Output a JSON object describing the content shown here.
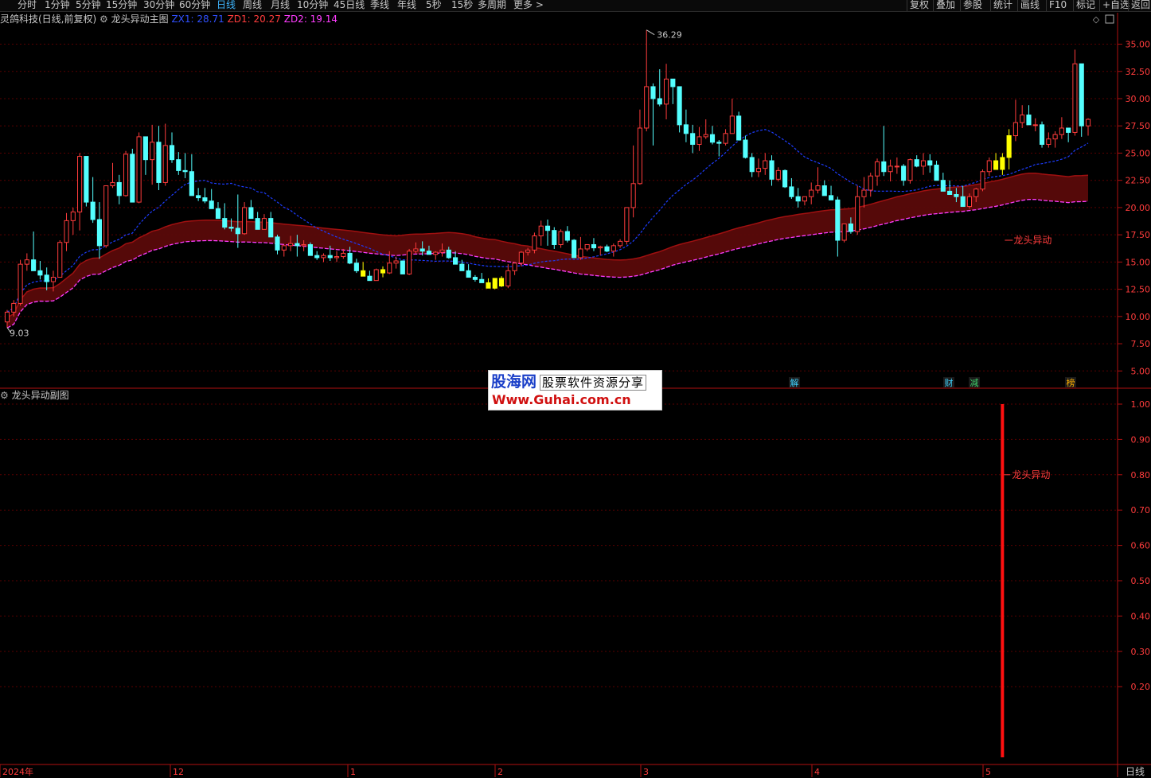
{
  "toolbar": {
    "periods": [
      "分时",
      "1分钟",
      "5分钟",
      "15分钟",
      "30分钟",
      "60分钟",
      "日线",
      "周线",
      "月线",
      "10分钟",
      "45日线",
      "季线",
      "年线",
      "5秒",
      "15秒",
      "多周期",
      "更多 >"
    ],
    "active_period": "日线",
    "right_buttons": [
      "复权",
      "叠加",
      "参股",
      "统计",
      "画线",
      "F10",
      "标记",
      "+自选",
      "返回"
    ]
  },
  "main_panel": {
    "stock": "灵鸽科技(日线,前复权)",
    "indicator_name": "龙头异动主图",
    "zx1_label": "ZX1: 28.71",
    "zd1_label": "ZD1: 20.27",
    "zd2_label": "ZD2: 19.14",
    "high_marker": "36.29",
    "low_marker": "9.03",
    "signal_label": "龙头异动",
    "event_badges": [
      "解",
      "财",
      "减",
      "榜"
    ]
  },
  "sub_panel": {
    "indicator_name": "龙头异动副图",
    "signal_label": "龙头异动"
  },
  "watermark": {
    "brand": "股海网",
    "tagline": "股票软件资源分享",
    "url": "Www.Guhai.com.cn"
  },
  "date_axis": [
    "2024年",
    "12",
    "1",
    "2",
    "3",
    "4",
    "5"
  ],
  "period_label": "日线",
  "colors": {
    "up": "#ff3c3c",
    "down": "#54ffff",
    "signal": "#ffff00",
    "ma_blue": "#1d3cff",
    "ma_magenta": "#ff3cff",
    "band_fill": "#5a0a0a",
    "grid": "#5a0000"
  },
  "chart_data": [
    {
      "type": "candlestick",
      "title": "龙头异动主图",
      "y_ticks": [
        35.0,
        32.5,
        30.0,
        27.5,
        25.0,
        22.5,
        20.0,
        17.5,
        15.0,
        12.5,
        10.0,
        7.5,
        5.0
      ],
      "ylim": [
        4.0,
        36.5
      ],
      "x_ticks": [
        "2024年",
        "12",
        "1",
        "2",
        "3",
        "4",
        "5"
      ],
      "ohlc": [
        [
          9.5,
          10.6,
          9.0,
          10.4
        ],
        [
          10.4,
          11.5,
          10.0,
          11.2
        ],
        [
          11.2,
          15.2,
          11.0,
          14.8
        ],
        [
          14.8,
          15.8,
          14.2,
          15.2
        ],
        [
          15.2,
          17.8,
          14.6,
          14.2
        ],
        [
          14.2,
          15.1,
          13.4,
          13.8
        ],
        [
          13.8,
          14.5,
          12.4,
          13.2
        ],
        [
          13.2,
          14.2,
          12.3,
          13.6
        ],
        [
          13.6,
          17.0,
          13.6,
          16.8
        ],
        [
          16.8,
          19.5,
          16.0,
          18.8
        ],
        [
          18.8,
          20.0,
          17.5,
          19.6
        ],
        [
          19.6,
          25.0,
          17.9,
          24.7
        ],
        [
          24.7,
          23.5,
          20.1,
          20.5
        ],
        [
          20.5,
          22.8,
          18.6,
          18.9
        ],
        [
          18.9,
          20.5,
          15.3,
          16.5
        ],
        [
          16.5,
          22.0,
          16.3,
          22.0
        ],
        [
          22.0,
          24.1,
          21.8,
          22.3
        ],
        [
          22.3,
          23.0,
          20.3,
          21.1
        ],
        [
          21.1,
          25.2,
          21.0,
          24.9
        ],
        [
          24.9,
          25.4,
          21.3,
          20.5
        ],
        [
          20.5,
          26.9,
          20.4,
          26.5
        ],
        [
          26.5,
          25.5,
          23.0,
          24.4
        ],
        [
          24.4,
          27.6,
          22.1,
          26.0
        ],
        [
          26.0,
          27.5,
          21.6,
          22.3
        ],
        [
          22.3,
          27.7,
          22.0,
          25.7
        ],
        [
          25.7,
          26.9,
          24.1,
          24.4
        ],
        [
          24.4,
          25.1,
          23.0,
          23.4
        ],
        [
          23.4,
          25.0,
          22.7,
          23.3
        ],
        [
          23.3,
          24.9,
          21.3,
          21.1
        ],
        [
          21.1,
          21.8,
          20.6,
          20.9
        ],
        [
          20.9,
          21.8,
          20.4,
          20.6
        ],
        [
          20.6,
          21.7,
          20.1,
          19.9
        ],
        [
          19.9,
          20.5,
          19.0,
          19.0
        ],
        [
          19.0,
          20.4,
          18.0,
          18.2
        ],
        [
          18.2,
          19.0,
          17.8,
          18.1
        ],
        [
          18.1,
          21.2,
          16.3,
          17.6
        ],
        [
          17.6,
          20.5,
          17.5,
          20.0
        ],
        [
          20.0,
          20.7,
          19.1,
          19.0
        ],
        [
          19.0,
          19.6,
          18.5,
          18.0
        ],
        [
          18.0,
          19.4,
          18.1,
          19.0
        ],
        [
          19.0,
          19.6,
          17.4,
          17.3
        ],
        [
          17.3,
          17.5,
          15.7,
          16.1
        ],
        [
          16.1,
          16.6,
          15.5,
          16.5
        ],
        [
          16.5,
          17.4,
          16.0,
          16.7
        ],
        [
          16.7,
          17.5,
          15.5,
          16.5
        ],
        [
          16.5,
          17.0,
          16.0,
          16.6
        ],
        [
          16.6,
          16.8,
          15.7,
          15.6
        ],
        [
          15.6,
          16.0,
          15.2,
          15.4
        ],
        [
          15.4,
          15.8,
          15.0,
          15.6
        ],
        [
          15.6,
          16.5,
          15.1,
          15.4
        ],
        [
          15.4,
          16.0,
          15.0,
          15.5
        ],
        [
          15.5,
          16.2,
          15.3,
          15.8
        ],
        [
          15.8,
          16.4,
          14.8,
          14.9
        ],
        [
          14.9,
          15.3,
          14.0,
          14.2
        ],
        [
          14.2,
          15.0,
          13.7,
          13.7
        ],
        [
          13.7,
          14.2,
          13.4,
          13.3
        ],
        [
          13.3,
          14.4,
          13.5,
          14.3
        ],
        [
          14.3,
          14.6,
          13.6,
          14.0
        ],
        [
          14.0,
          16.0,
          13.9,
          14.9
        ],
        [
          14.9,
          15.5,
          14.4,
          15.1
        ],
        [
          15.1,
          15.0,
          14.2,
          13.9
        ],
        [
          13.9,
          16.2,
          13.8,
          16.0
        ],
        [
          16.0,
          16.8,
          15.8,
          16.2
        ],
        [
          16.2,
          16.9,
          15.6,
          16.0
        ],
        [
          16.0,
          16.5,
          15.7,
          15.7
        ],
        [
          15.7,
          16.0,
          15.2,
          15.9
        ],
        [
          15.9,
          16.7,
          15.5,
          16.1
        ],
        [
          16.1,
          16.4,
          15.3,
          15.4
        ],
        [
          15.4,
          16.0,
          14.8,
          14.8
        ],
        [
          14.8,
          15.2,
          14.2,
          14.2
        ],
        [
          14.2,
          14.8,
          13.7,
          13.6
        ],
        [
          13.6,
          13.8,
          13.2,
          13.4
        ],
        [
          13.4,
          14.0,
          13.1,
          13.1
        ],
        [
          13.1,
          13.5,
          12.6,
          12.6
        ],
        [
          12.6,
          13.1,
          12.5,
          13.5
        ],
        [
          13.5,
          13.7,
          12.7,
          12.8
        ],
        [
          12.8,
          14.8,
          12.6,
          14.2
        ],
        [
          14.2,
          15.0,
          13.8,
          14.9
        ],
        [
          14.9,
          16.0,
          14.6,
          15.9
        ],
        [
          15.9,
          16.3,
          15.6,
          16.1
        ],
        [
          16.1,
          17.7,
          15.8,
          17.4
        ],
        [
          17.4,
          18.8,
          16.5,
          18.3
        ],
        [
          18.3,
          18.9,
          16.5,
          17.9
        ],
        [
          17.9,
          18.2,
          16.2,
          16.6
        ],
        [
          16.6,
          18.0,
          16.3,
          17.8
        ],
        [
          17.8,
          18.3,
          16.8,
          17.0
        ],
        [
          17.0,
          17.1,
          15.7,
          15.4
        ],
        [
          15.4,
          17.3,
          15.2,
          16.2
        ],
        [
          16.2,
          16.6,
          16.0,
          16.6
        ],
        [
          16.6,
          17.2,
          16.0,
          16.3
        ],
        [
          16.3,
          16.5,
          15.6,
          16.4
        ],
        [
          16.4,
          16.6,
          15.9,
          16.0
        ],
        [
          16.0,
          16.7,
          15.5,
          16.5
        ],
        [
          16.5,
          17.1,
          16.3,
          16.9
        ],
        [
          16.9,
          18.0,
          16.6,
          20.0
        ],
        [
          20.0,
          25.7,
          19.1,
          22.2
        ],
        [
          22.2,
          29.0,
          22.1,
          27.3
        ],
        [
          27.3,
          36.3,
          27.0,
          31.1
        ],
        [
          31.1,
          31.4,
          25.7,
          30.0
        ],
        [
          30.0,
          32.7,
          29.3,
          29.5
        ],
        [
          29.5,
          33.2,
          28.1,
          31.8
        ],
        [
          31.8,
          31.8,
          29.5,
          31.1
        ],
        [
          31.1,
          30.1,
          26.9,
          27.6
        ],
        [
          27.6,
          29.0,
          26.0,
          26.8
        ],
        [
          26.8,
          27.6,
          25.0,
          25.8
        ],
        [
          25.8,
          27.4,
          25.2,
          26.5
        ],
        [
          26.5,
          28.1,
          26.3,
          26.7
        ],
        [
          26.7,
          27.5,
          25.8,
          26.0
        ],
        [
          26.0,
          26.2,
          24.7,
          25.9
        ],
        [
          25.9,
          27.2,
          25.7,
          26.8
        ],
        [
          26.8,
          30.0,
          26.8,
          28.4
        ],
        [
          28.4,
          28.8,
          26.3,
          26.2
        ],
        [
          26.2,
          26.6,
          24.5,
          24.6
        ],
        [
          24.6,
          25.0,
          22.8,
          23.3
        ],
        [
          23.3,
          24.5,
          22.8,
          23.6
        ],
        [
          23.6,
          25.0,
          23.0,
          24.3
        ],
        [
          24.3,
          24.8,
          22.0,
          22.6
        ],
        [
          22.6,
          23.7,
          22.4,
          23.4
        ],
        [
          23.4,
          23.5,
          21.8,
          21.9
        ],
        [
          21.9,
          22.7,
          20.8,
          21.0
        ],
        [
          21.0,
          21.8,
          20.0,
          20.6
        ],
        [
          20.6,
          21.0,
          20.2,
          21.0
        ],
        [
          21.0,
          22.3,
          20.3,
          21.6
        ],
        [
          21.6,
          23.7,
          21.3,
          22.0
        ],
        [
          22.0,
          22.5,
          21.2,
          21.1
        ],
        [
          21.1,
          22.0,
          20.7,
          20.7
        ],
        [
          20.7,
          21.0,
          15.5,
          17.0
        ],
        [
          17.0,
          18.5,
          16.8,
          18.5
        ],
        [
          18.5,
          19.1,
          17.6,
          17.8
        ],
        [
          17.8,
          22.0,
          17.5,
          21.0
        ],
        [
          21.0,
          22.8,
          20.0,
          21.6
        ],
        [
          21.6,
          23.2,
          21.0,
          22.9
        ],
        [
          22.9,
          24.5,
          22.0,
          24.2
        ],
        [
          24.2,
          27.5,
          22.9,
          23.3
        ],
        [
          23.3,
          24.4,
          22.4,
          23.8
        ],
        [
          23.8,
          24.6,
          23.1,
          23.8
        ],
        [
          23.8,
          24.0,
          22.0,
          22.5
        ],
        [
          22.5,
          24.5,
          22.2,
          24.4
        ],
        [
          24.4,
          24.8,
          23.7,
          23.8
        ],
        [
          23.8,
          25.0,
          23.0,
          24.3
        ],
        [
          24.3,
          24.9,
          23.2,
          23.9
        ],
        [
          23.9,
          24.3,
          22.7,
          22.5
        ],
        [
          22.5,
          23.2,
          22.0,
          21.5
        ],
        [
          21.5,
          22.5,
          21.2,
          21.2
        ],
        [
          21.2,
          21.8,
          20.5,
          21.0
        ],
        [
          21.0,
          22.0,
          20.4,
          20.1
        ],
        [
          20.1,
          21.3,
          19.9,
          21.0
        ],
        [
          21.0,
          21.8,
          20.5,
          21.7
        ],
        [
          21.7,
          23.5,
          21.5,
          23.3
        ],
        [
          23.3,
          24.6,
          22.9,
          24.3
        ],
        [
          24.3,
          25.0,
          23.5,
          23.5
        ],
        [
          23.5,
          25.0,
          23.0,
          24.6
        ],
        [
          24.6,
          27.2,
          23.5,
          26.6
        ],
        [
          26.6,
          29.9,
          26.1,
          27.8
        ],
        [
          27.8,
          29.4,
          27.3,
          28.5
        ],
        [
          28.5,
          29.4,
          27.6,
          27.6
        ],
        [
          27.6,
          28.2,
          27.0,
          27.6
        ],
        [
          27.6,
          27.9,
          25.5,
          25.8
        ],
        [
          25.8,
          26.9,
          25.5,
          26.3
        ],
        [
          26.3,
          27.0,
          25.5,
          26.7
        ],
        [
          26.7,
          28.3,
          26.3,
          27.3
        ],
        [
          27.3,
          27.2,
          26.0,
          26.9
        ],
        [
          26.9,
          34.5,
          26.6,
          33.2
        ],
        [
          33.2,
          33.0,
          26.5,
          27.5
        ],
        [
          27.5,
          28.2,
          26.6,
          28.1
        ]
      ],
      "signal_candles": [
        54,
        57,
        73,
        74,
        75,
        150,
        151,
        152
      ]
    },
    {
      "type": "bar",
      "title": "龙头异动副图",
      "y_ticks": [
        1.0,
        0.9,
        0.8,
        0.7,
        0.6,
        0.5,
        0.4,
        0.3,
        0.2
      ],
      "ylim": [
        0,
        1
      ],
      "signal_index": 151,
      "signal_value": 1.0
    }
  ]
}
